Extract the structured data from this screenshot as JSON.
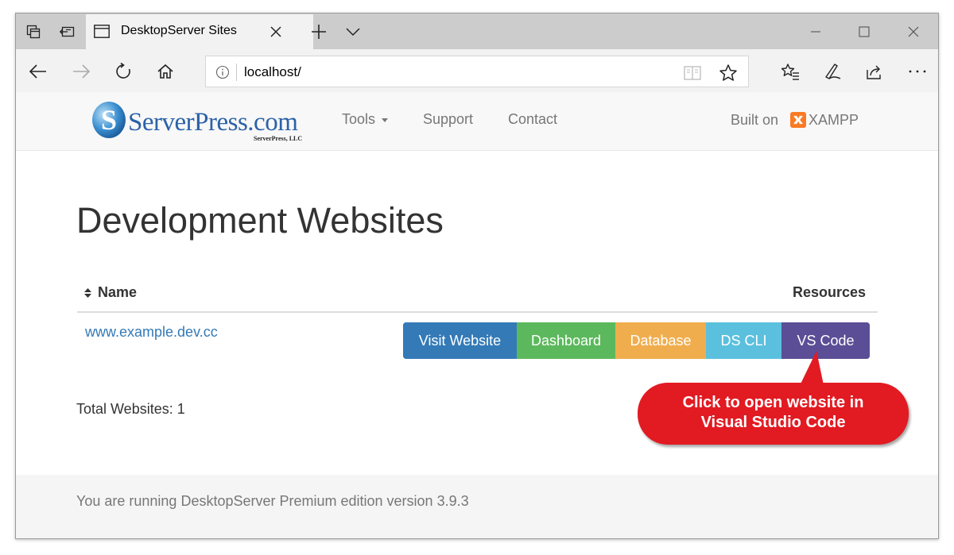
{
  "browser": {
    "tab_title": "DesktopServer Sites",
    "url": "localhost/"
  },
  "site_nav": {
    "logo_text": "ServerPress.com",
    "logo_sub": "ServerPress, LLC",
    "menu": [
      {
        "label": "Tools"
      },
      {
        "label": "Support"
      },
      {
        "label": "Contact"
      }
    ],
    "built_on_label": "Built on",
    "xampp_label": "XAMPP"
  },
  "main": {
    "heading": "Development Websites",
    "table": {
      "col_name": "Name",
      "col_resources": "Resources",
      "rows": [
        {
          "site": "www.example.dev.cc"
        }
      ]
    },
    "buttons": [
      {
        "label": "Visit Website",
        "color": "#337ab7"
      },
      {
        "label": "Dashboard",
        "color": "#5cb85c"
      },
      {
        "label": "Database",
        "color": "#f0ad4e"
      },
      {
        "label": "DS CLI",
        "color": "#5bc0de"
      },
      {
        "label": "VS Code",
        "color": "#5b4e96"
      }
    ],
    "total": "Total Websites: 1"
  },
  "callout": {
    "line1": "Click to open website in",
    "line2": "Visual Studio Code",
    "color": "#e21a22"
  },
  "footer": {
    "text": "You are running DesktopServer Premium edition version 3.9.3"
  }
}
